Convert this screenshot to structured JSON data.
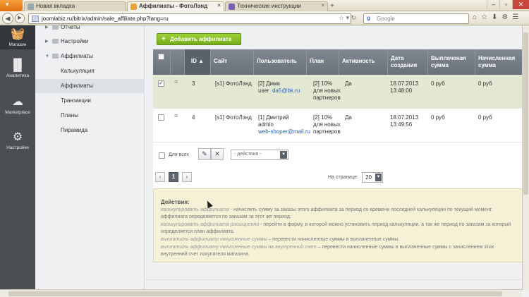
{
  "browser": {
    "tabs": [
      {
        "label": "Новая вкладка",
        "active": false
      },
      {
        "label": "Аффилиаты - ФотоЛэнд",
        "active": true
      },
      {
        "label": "Технические инструкции",
        "active": false
      }
    ],
    "url": "joomlabiz.ru/bitrix/admin/sale_affiliate.php?lang=ru",
    "search_placeholder": "Google",
    "search_engine_glyph": "g"
  },
  "leftbar": [
    {
      "label": "Магазин",
      "icon": "basket-icon",
      "active": true
    },
    {
      "label": "Аналитика",
      "icon": "bar-chart-icon",
      "active": false
    },
    {
      "label": "Marketplace",
      "icon": "cloud-download-icon",
      "active": false
    },
    {
      "label": "Настройки",
      "icon": "gear-icon",
      "active": false
    }
  ],
  "submenu": [
    {
      "label": "Отчеты",
      "level": 0
    },
    {
      "label": "Настройки",
      "level": 0
    },
    {
      "label": "Аффилиаты",
      "level": 0,
      "expanded": true
    },
    {
      "label": "Калькуляция",
      "level": 1
    },
    {
      "label": "Аффилиаты",
      "level": 1,
      "selected": true
    },
    {
      "label": "Транзакции",
      "level": 1
    },
    {
      "label": "Планы",
      "level": 1
    },
    {
      "label": "Пирамида",
      "level": 1
    }
  ],
  "toolbar": {
    "add_label": "Добавить аффилиата"
  },
  "table": {
    "columns": [
      "ID",
      "Сайт",
      "Пользователь",
      "План",
      "Активность",
      "Дата создания",
      "Выплаченая сумма",
      "Начисленная сумма"
    ],
    "rows": [
      {
        "checked": true,
        "id": "3",
        "site": "[s1] ФотоЛэнд",
        "user_line1": "[2] Дима",
        "user_login": "user",
        "user_email": "da5@bk.ru",
        "plan": "[2] 10% для новых партнеров",
        "active": "Да",
        "created": "18.07.2013 13:48:00",
        "paid": "0 руб",
        "accrued": "0 руб"
      },
      {
        "checked": false,
        "id": "4",
        "site": "[s1] ФотоЛэнд",
        "user_line1": "[1] Дмитрий",
        "user_login": "admin",
        "user_email": "web-shoper@mail.ru",
        "plan": "[2] 10% для новых партнеров",
        "active": "Да",
        "created": "18.07.2013 13:49:56",
        "paid": "0 руб",
        "accrued": "0 руб"
      }
    ],
    "footer": {
      "for_all_label": "Для всех",
      "actions_select": "- действия -"
    }
  },
  "pager": {
    "prev": "‹",
    "current": "1",
    "next": "›",
    "per_page_label": "На странице:",
    "per_page_value": "20"
  },
  "help": {
    "title": "Действия:",
    "line1_em": "калькулировать аффилиата",
    "line1_rest": " - начислить сумму за заказы этого аффилиата за период со времени последней калькуляции по текущий момент.",
    "line2": "аффилиата определяется по заказам за этот же период.",
    "line3_em": "калькулировать аффилиата расширенно",
    "line3_rest": " - перейти в форму, в которой можно установить период калькуляции, а так же период по заказам за который",
    "line4": "определяется план аффилиата.",
    "line5_em": "выплатить аффилиату начисленные суммы",
    "line5_rest": " – перевести начисленные суммы в выплаченные суммы.",
    "line6_em": "выплатить аффилиату начисленные суммы на внутренний счет",
    "line6_rest": " – перевести начисленные суммы в выплаченные суммы с зачислением этих",
    "line7": "внутренний счет покупателя магазина."
  }
}
